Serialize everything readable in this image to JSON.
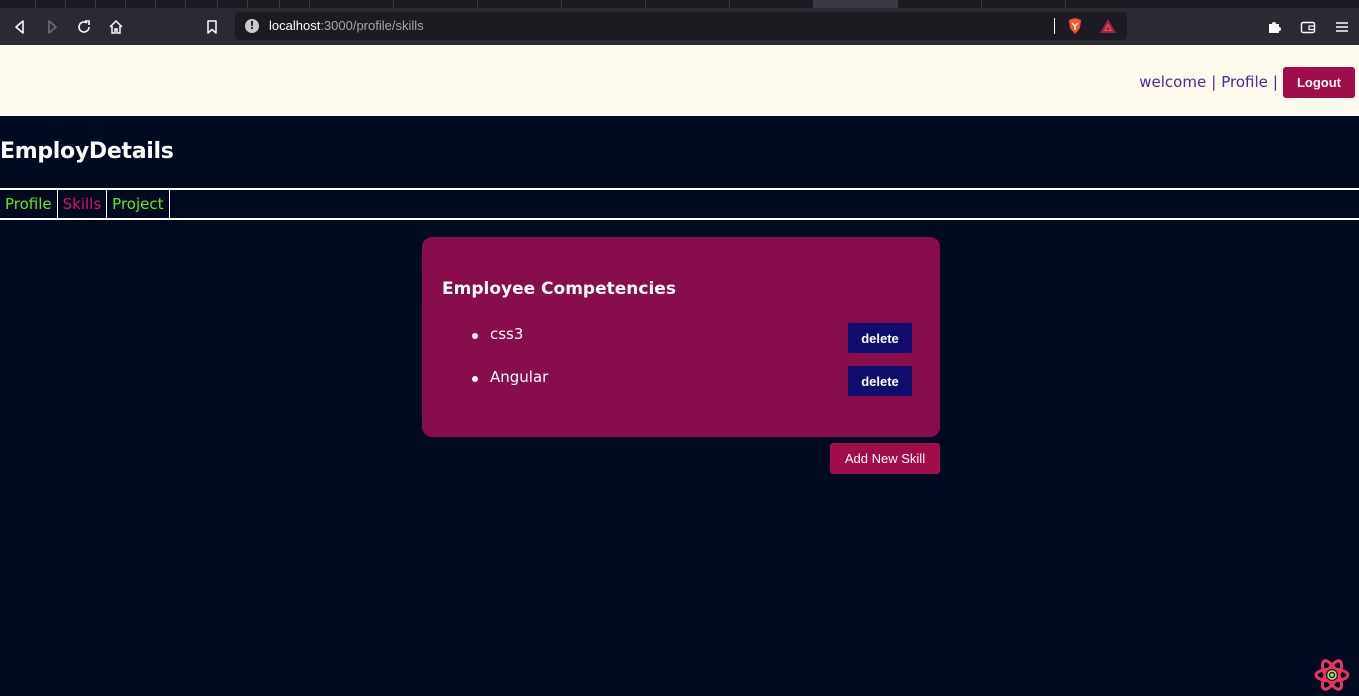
{
  "browser": {
    "url_host": "localhost",
    "url_path": ":3000/profile/skills"
  },
  "header": {
    "welcome_label": "welcome",
    "separator": "|",
    "profile_label": "Profile",
    "logout_label": "Logout"
  },
  "app_title": "EmployDetails",
  "tabs": [
    {
      "label": "Profile"
    },
    {
      "label": "Skills"
    },
    {
      "label": "Project"
    }
  ],
  "card": {
    "title": "Employee Competencies",
    "skills": [
      {
        "name": "css3",
        "delete_label": "delete"
      },
      {
        "name": "Angular",
        "delete_label": "delete"
      }
    ]
  },
  "add_skill_label": "Add New Skill",
  "colors": {
    "page_bg": "#000a21",
    "header_bg": "#fffaee",
    "card_bg": "#870d4c",
    "accent_button": "#a30c4a",
    "delete_button": "#0e0d6b",
    "tab_inactive": "#5fe81c",
    "tab_active": "#e0115f"
  },
  "icons": [
    "back-icon",
    "forward-icon",
    "reload-icon",
    "home-icon",
    "bookmark-icon",
    "site-info-icon",
    "brave-shields-icon",
    "brave-rewards-icon",
    "extensions-icon",
    "wallet-icon",
    "menu-icon",
    "react-devtools-icon"
  ]
}
